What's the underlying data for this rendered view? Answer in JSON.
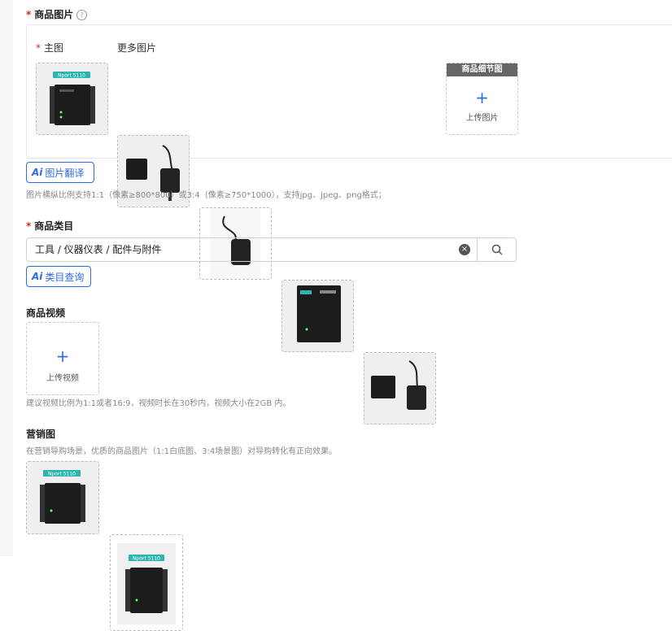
{
  "product_images": {
    "label": "商品图片",
    "help_icon": "question-circle-icon",
    "main_label": "主图",
    "more_label": "更多图片",
    "thumb_alt": "Nport 5110",
    "detail_tile_header": "商品细节图",
    "upload_label": "上传图片",
    "translate_button": "图片翻译",
    "hint": "图片横纵比例支持1:1（像素≥800*800）或3:4（像素≥750*1000），支持jpg、jpeg、png格式；"
  },
  "category": {
    "label": "商品类目",
    "value": "工具 / 仪器仪表 / 配件与附件",
    "lookup_button": "类目查询"
  },
  "video": {
    "label": "商品视频",
    "upload_label": "上传视频",
    "hint": "建议视频比例为1:1或者16:9，视频时长在30秒内，视频大小在2GB 内。"
  },
  "marketing": {
    "label": "营销图",
    "hint": "在营销导购场景，优质的商品图片（1:1白底图、3:4场景图）对导购转化有正向效果。"
  },
  "ai_badge": "Ai",
  "colors": {
    "accent": "#2d6ce6",
    "required": "#e02020",
    "device_label": "#2bb5b0"
  }
}
